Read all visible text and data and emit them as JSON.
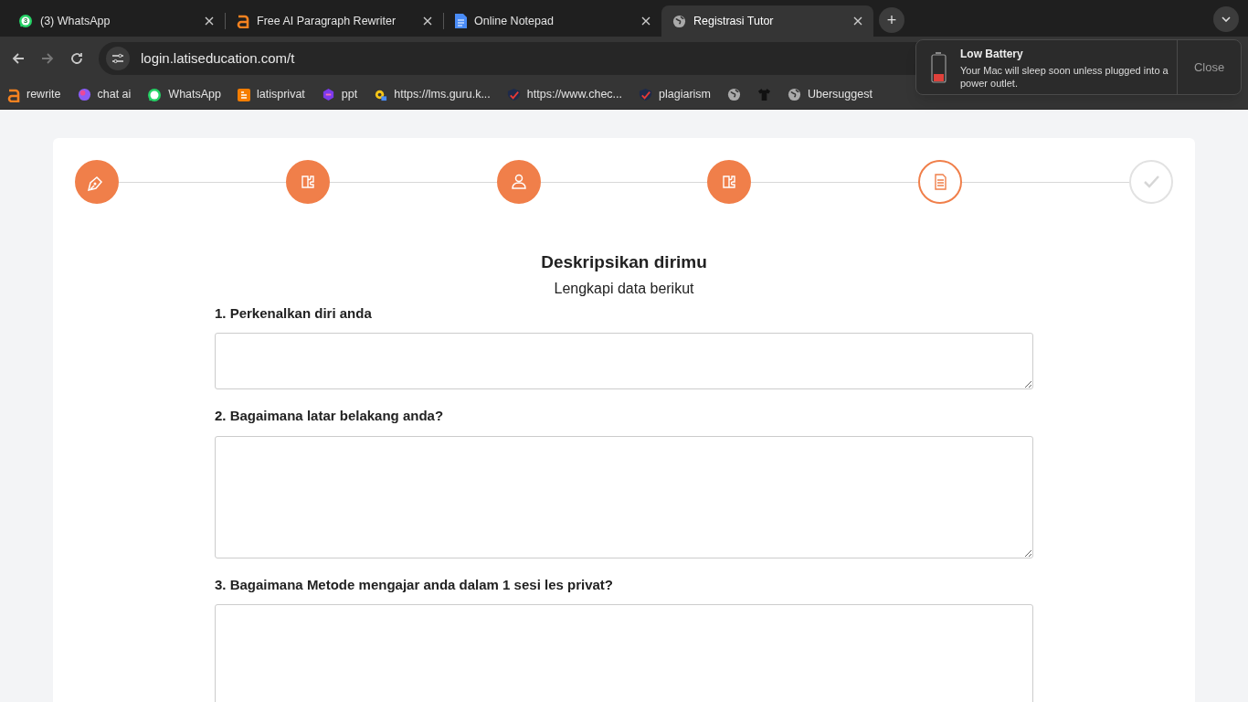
{
  "tabs": [
    {
      "title": "(3) WhatsApp",
      "badge": "3",
      "selected": false
    },
    {
      "title": "Free AI Paragraph Rewriter",
      "selected": false
    },
    {
      "title": "Online Notepad",
      "selected": false
    },
    {
      "title": "Registrasi Tutor",
      "selected": true
    }
  ],
  "new_tab": "+",
  "address_bar": {
    "url": "login.latiseducation.com/t"
  },
  "bookmarks": [
    {
      "label": "rewrite"
    },
    {
      "label": "chat ai"
    },
    {
      "label": "WhatsApp"
    },
    {
      "label": "latisprivat"
    },
    {
      "label": "ppt"
    },
    {
      "label": "https://lms.guru.k..."
    },
    {
      "label": "https://www.chec..."
    },
    {
      "label": "plagiarism"
    },
    {
      "label": "Ubersuggest"
    }
  ],
  "notification": {
    "title": "Low Battery",
    "message": "Your Mac will sleep soon unless plugged into a power outlet.",
    "button": "Close"
  },
  "stepper": [
    {
      "kind": "done"
    },
    {
      "kind": "done"
    },
    {
      "kind": "done"
    },
    {
      "kind": "done"
    },
    {
      "kind": "current"
    },
    {
      "kind": "pending"
    }
  ],
  "form": {
    "title": "Deskripsikan dirimu",
    "subtitle": "Lengkapi data berikut",
    "questions": [
      {
        "label": "1. Perkenalkan diri anda"
      },
      {
        "label": "2. Bagaimana latar belakang anda?"
      },
      {
        "label": "3. Bagaimana Metode mengajar anda dalam 1 sesi les privat?"
      }
    ]
  }
}
